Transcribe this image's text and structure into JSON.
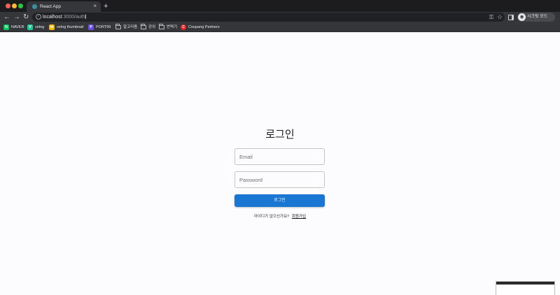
{
  "browser": {
    "tab_title": "React App",
    "tab_close": "×",
    "new_tab": "+",
    "nav": {
      "back": "←",
      "forward": "→",
      "reload": "↻"
    },
    "url_host": "localhost",
    "url_path": ":3000/auth",
    "info_icon": "i",
    "key_icon": "⚿",
    "star_icon": "☆",
    "profile_label": "시크릿 모드",
    "profile_avatar": "◉",
    "bookmarks": [
      {
        "label": "NAVER",
        "icon": "N",
        "icon_color": "#03c75a",
        "type": "site"
      },
      {
        "label": "velog",
        "icon": "V",
        "icon_color": "#20c997",
        "type": "site"
      },
      {
        "label": "velog thumbnail",
        "icon": "✉",
        "icon_color": "#f5b800",
        "type": "site"
      },
      {
        "label": "PORT99",
        "icon": "P",
        "icon_color": "#6b4de6",
        "type": "site"
      },
      {
        "label": "알고리즘",
        "icon": "folder-icon",
        "type": "folder"
      },
      {
        "label": "강의",
        "icon": "folder-icon",
        "type": "folder"
      },
      {
        "label": "번역기",
        "icon": "folder-icon",
        "type": "folder"
      },
      {
        "label": "Coupang Partners",
        "icon": "C",
        "icon_color": "#e52528",
        "type": "site"
      }
    ]
  },
  "login": {
    "title": "로그인",
    "email_placeholder": "Email",
    "password_placeholder": "Password",
    "submit_label": "로그인",
    "signup_prompt": "아이디가 없으신가요?",
    "signup_link": "회원가입",
    "accent_color": "#1976d2"
  }
}
